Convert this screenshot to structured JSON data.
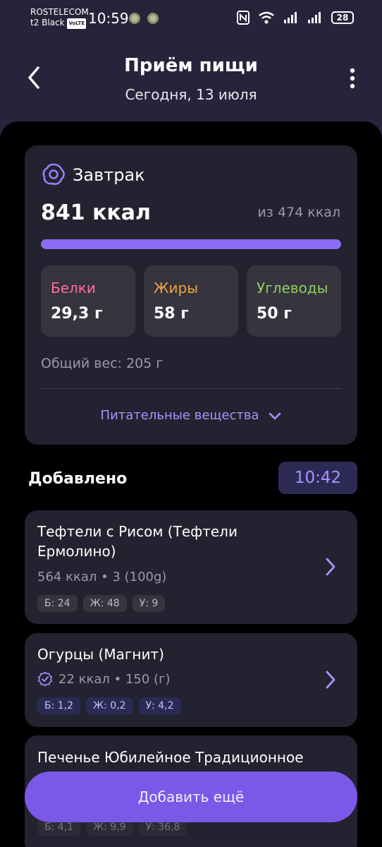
{
  "status": {
    "carrier_line1": "ROSTELECOM",
    "carrier_line2": "t2 Black",
    "volte": "VoLTE",
    "time": "10:59",
    "battery": "28"
  },
  "header": {
    "title": "Приём пищи",
    "date": "Сегодня, 13 июля"
  },
  "meal": {
    "name": "Завтрак",
    "kcal": "841 ккал",
    "kcal_of": "из 474 ккал",
    "progress_percent": 100,
    "protein_label": "Белки",
    "protein_value": "29,3 г",
    "fat_label": "Жиры",
    "fat_value": "58 г",
    "carb_label": "Углеводы",
    "carb_value": "50 г",
    "weight": "Общий вес: 205 г",
    "nutrients_label": "Питательные вещества"
  },
  "added": {
    "label": "Добавлено",
    "time": "10:42"
  },
  "foods": [
    {
      "name": "Тефтели с Рисом (Тефтели Ермолино)",
      "meta": "564 ккал • 3 (100g)",
      "protein": "Б: 24",
      "fat": "Ж: 48",
      "carb": "У: 9"
    },
    {
      "name": "Огурцы (Магнит)",
      "meta": "22 ккал • 150 (г)",
      "protein": "Б: 1,2",
      "fat": "Ж: 0,2",
      "carb": "У: 4,2"
    },
    {
      "name": "Печенье Юбилейное Традиционное",
      "protein": "Б: 4,1",
      "fat": "Ж: 9,9",
      "carb": "У: 36,8"
    }
  ],
  "add_more": "Добавить ещё",
  "colors": {
    "accent": "#8b6cf5",
    "protein": "#ff6f9c",
    "fat": "#f2a33a",
    "carb": "#8fcf5a"
  }
}
